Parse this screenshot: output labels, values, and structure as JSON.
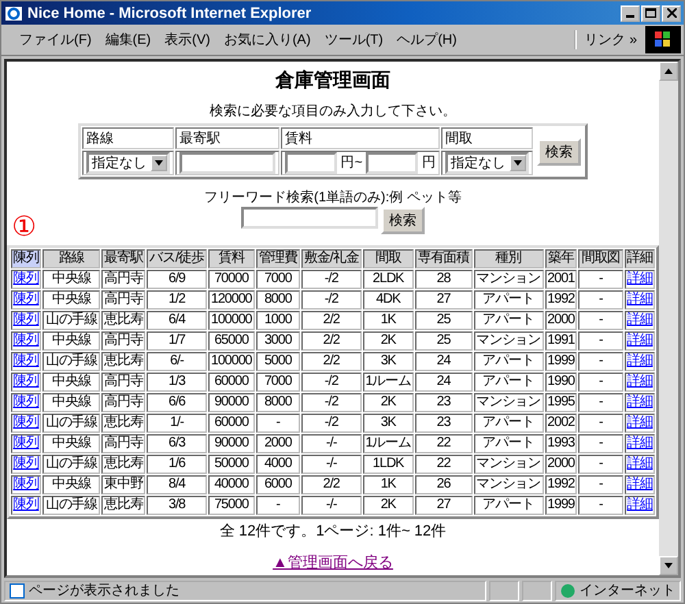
{
  "window": {
    "title": "Nice Home - Microsoft Internet Explorer"
  },
  "menu": [
    "ファイル(F)",
    "編集(E)",
    "表示(V)",
    "お気に入り(A)",
    "ツール(T)",
    "ヘルプ(H)"
  ],
  "links_label": "リンク",
  "links_chevron": "»",
  "page_title": "倉庫管理画面",
  "search": {
    "instruction": "検索に必要な項目のみ入力して下さい。",
    "headers": [
      "路線",
      "最寄駅",
      "賃料",
      "間取"
    ],
    "line_select": "指定なし",
    "rent_from_unit": "円~",
    "rent_to_unit": "円",
    "layout_select": "指定なし",
    "button": "検索"
  },
  "freeword": {
    "label": "フリーワード検索(1単語のみ):例 ペット等",
    "button": "検索"
  },
  "annotation": "①",
  "table": {
    "columns": [
      {
        "label": "陳列",
        "selected": true
      },
      {
        "label": "路線",
        "selected": false
      },
      {
        "label": "最寄駅",
        "selected": false
      },
      {
        "label": "バス/徒歩",
        "selected": false
      },
      {
        "label": "賃料",
        "selected": false
      },
      {
        "label": "管理費",
        "selected": false
      },
      {
        "label": "敷金/礼金",
        "selected": false
      },
      {
        "label": "間取",
        "selected": false
      },
      {
        "label": "専有面積",
        "selected": false
      },
      {
        "label": "種別",
        "selected": false
      },
      {
        "label": "築年",
        "selected": false
      },
      {
        "label": "間取図",
        "selected": false
      },
      {
        "label": "詳細",
        "selected": false
      }
    ],
    "rows": [
      [
        "陳列",
        "中央線",
        "高円寺",
        "6/9",
        "70000",
        "7000",
        "-/2",
        "2LDK",
        "28",
        "マンション",
        "2001",
        "-",
        "詳細"
      ],
      [
        "陳列",
        "中央線",
        "高円寺",
        "1/2",
        "120000",
        "8000",
        "-/2",
        "4DK",
        "27",
        "アパート",
        "1992",
        "-",
        "詳細"
      ],
      [
        "陳列",
        "山の手線",
        "恵比寿",
        "6/4",
        "100000",
        "1000",
        "2/2",
        "1K",
        "25",
        "アパート",
        "2000",
        "-",
        "詳細"
      ],
      [
        "陳列",
        "中央線",
        "高円寺",
        "1/7",
        "65000",
        "3000",
        "2/2",
        "2K",
        "25",
        "マンション",
        "1991",
        "-",
        "詳細"
      ],
      [
        "陳列",
        "山の手線",
        "恵比寿",
        "6/-",
        "100000",
        "5000",
        "2/2",
        "3K",
        "24",
        "アパート",
        "1999",
        "-",
        "詳細"
      ],
      [
        "陳列",
        "中央線",
        "高円寺",
        "1/3",
        "60000",
        "7000",
        "-/2",
        "1ルーム",
        "24",
        "アパート",
        "1990",
        "-",
        "詳細"
      ],
      [
        "陳列",
        "中央線",
        "高円寺",
        "6/6",
        "90000",
        "8000",
        "-/2",
        "2K",
        "23",
        "マンション",
        "1995",
        "-",
        "詳細"
      ],
      [
        "陳列",
        "山の手線",
        "恵比寿",
        "1/-",
        "60000",
        "-",
        "-/2",
        "3K",
        "23",
        "アパート",
        "2002",
        "-",
        "詳細"
      ],
      [
        "陳列",
        "中央線",
        "高円寺",
        "6/3",
        "90000",
        "2000",
        "-/-",
        "1ルーム",
        "22",
        "アパート",
        "1993",
        "-",
        "詳細"
      ],
      [
        "陳列",
        "山の手線",
        "恵比寿",
        "1/6",
        "50000",
        "4000",
        "-/-",
        "1LDK",
        "22",
        "マンション",
        "2000",
        "-",
        "詳細"
      ],
      [
        "陳列",
        "中央線",
        "東中野",
        "8/4",
        "40000",
        "6000",
        "2/2",
        "1K",
        "26",
        "マンション",
        "1992",
        "-",
        "詳細"
      ],
      [
        "陳列",
        "山の手線",
        "恵比寿",
        "3/8",
        "75000",
        "-",
        "-/-",
        "2K",
        "27",
        "アパート",
        "1999",
        "-",
        "詳細"
      ]
    ]
  },
  "summary": "全 12件です。1ページ: 1件~ 12件",
  "back_link": "▲管理画面へ戻る",
  "status_bar": {
    "message": "ページが表示されました",
    "zone": "インターネット"
  }
}
